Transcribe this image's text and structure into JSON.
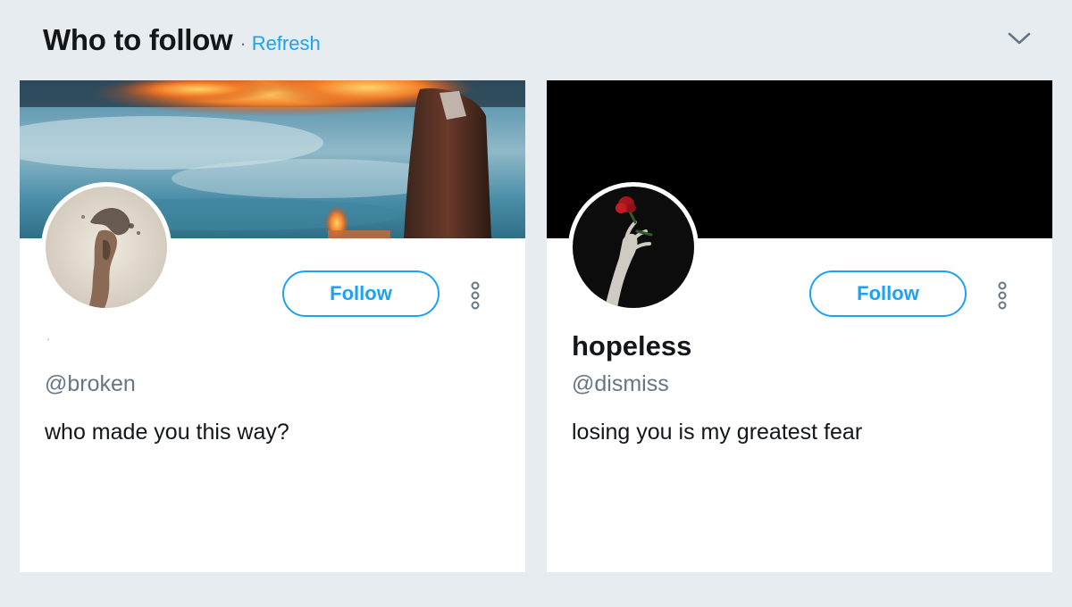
{
  "module": {
    "title": "Who to follow",
    "separator": "·",
    "refresh_label": "Refresh",
    "collapse_icon": "chevron-down-icon"
  },
  "colors": {
    "background": "#e6ecf0",
    "accent": "#1da1f2",
    "text_primary": "#14171a",
    "text_secondary": "#657786"
  },
  "suggestions": [
    {
      "display_name": "﹐",
      "handle": "@broken",
      "bio": "who made you this way?",
      "follow_label": "Follow",
      "more_icon": "more-vertical-icon",
      "banner": "painting of a man in a coat whose head is on fire above a misty sea",
      "avatar": "sepia figure dissolving into smoke"
    },
    {
      "display_name": "hopeless",
      "handle": "@dismiss",
      "bio": "losing you is my greatest fear",
      "follow_label": "Follow",
      "more_icon": "more-vertical-icon",
      "banner": "solid black",
      "avatar": "pale hand holding a red rose on black"
    }
  ]
}
